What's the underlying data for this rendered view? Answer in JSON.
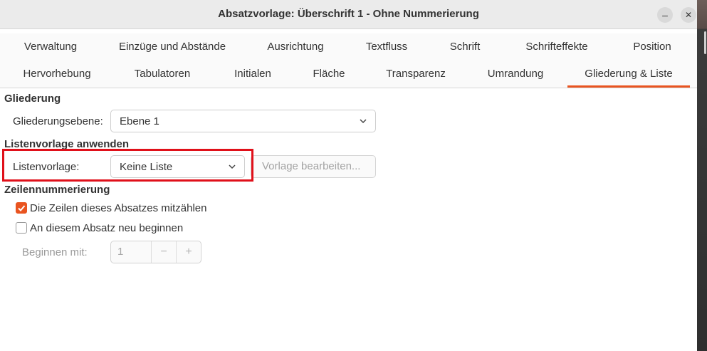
{
  "window": {
    "title": "Absatzvorlage: Überschrift 1 - Ohne Nummerierung",
    "minimize_glyph": "–",
    "close_glyph": "✕"
  },
  "tabs_row1": [
    {
      "label": "Verwaltung"
    },
    {
      "label": "Einzüge und Abstände"
    },
    {
      "label": "Ausrichtung"
    },
    {
      "label": "Textfluss"
    },
    {
      "label": "Schrift"
    },
    {
      "label": "Schrifteffekte"
    },
    {
      "label": "Position"
    }
  ],
  "tabs_row2": [
    {
      "label": "Hervorhebung"
    },
    {
      "label": "Tabulatoren"
    },
    {
      "label": "Initialen"
    },
    {
      "label": "Fläche"
    },
    {
      "label": "Transparenz"
    },
    {
      "label": "Umrandung"
    },
    {
      "label": "Gliederung & Liste",
      "active": true
    }
  ],
  "outline": {
    "heading": "Gliederung",
    "level_label": "Gliederungsebene:",
    "level_value": "Ebene 1"
  },
  "list_style": {
    "heading": "Listenvorlage anwenden",
    "label": "Listenvorlage:",
    "value": "Keine Liste",
    "edit_button": "Vorlage bearbeiten..."
  },
  "line_numbering": {
    "heading": "Zeilennummerierung",
    "count_lines_label": "Die Zeilen dieses Absatzes mitzählen",
    "count_lines_checked": true,
    "restart_label": "An diesem Absatz neu beginnen",
    "restart_checked": false,
    "start_with_label": "Beginnen mit:",
    "start_with_value": "1",
    "decrement_glyph": "−",
    "increment_glyph": "+"
  },
  "colors": {
    "accent": "#e95420",
    "highlight": "#e0101a"
  }
}
